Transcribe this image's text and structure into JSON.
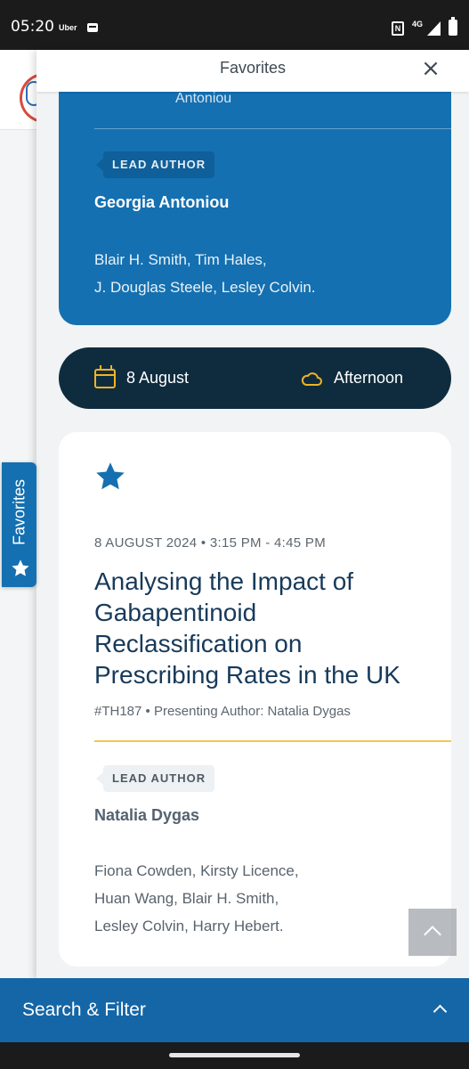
{
  "status_bar": {
    "time": "05:20",
    "carrier": "Uber",
    "network": "4G"
  },
  "drawer": {
    "title": "Favorites",
    "close_label": "×"
  },
  "prev_card": {
    "presenting_author_tail": "Antoniou",
    "lead_badge": "LEAD AUTHOR",
    "lead_author": "Georgia Antoniou",
    "coauthors_line1": "Blair H. Smith,  Tim Hales,",
    "coauthors_line2": "J. Douglas Steele,  Lesley Colvin."
  },
  "date_bar": {
    "date": "8 August",
    "time_of_day": "Afternoon"
  },
  "session": {
    "favorite_icon": "star-icon",
    "meta": "8 AUGUST 2024  •  3:15 PM  -  4:45 PM",
    "title": "Analysing the Impact of Gabapentinoid Reclassification on Prescribing Rates in the UK",
    "code_line": "#TH187  •  Presenting Author: Natalia Dygas",
    "lead_badge": "LEAD AUTHOR",
    "lead_author": "Natalia Dygas",
    "coauthors_line1": "Fiona Cowden,  Kirsty Licence,",
    "coauthors_line2": "Huan Wang,  Blair H. Smith,",
    "coauthors_line3": "Lesley Colvin,  Harry Hebert."
  },
  "side_tab": {
    "label": "Favorites"
  },
  "bottom_bar": {
    "label": "Search & Filter"
  },
  "colors": {
    "accent_blue": "#1470b1",
    "dark_navy": "#0f2c3f",
    "accent_yellow": "#f0b324",
    "bottom_bar": "#1466a6"
  }
}
